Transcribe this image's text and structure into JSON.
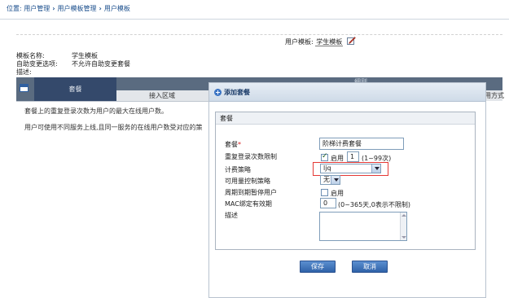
{
  "breadcrumb": {
    "prefix": "位置:",
    "items": [
      "用户管理",
      "用户模板管理",
      "用户模板"
    ]
  },
  "template_header": {
    "label": "用户模板:",
    "value": "学生模板"
  },
  "info": {
    "name_label": "模板名称:",
    "name_value": "学生模板",
    "selfchange_label": "自助变更选项:",
    "selfchange_value": "不允许自助变更套餐",
    "desc_label": "描述:"
  },
  "table": {
    "col_package": "套餐",
    "col_region": "接入区域",
    "col_stat": "细则",
    "col_method": "用方式"
  },
  "notes": {
    "line1": "套餐上的重复登录次数为用户的最大在线用户数。",
    "line2": "用户可使用不同服务上线,且同一服务的在线用户数受对应的策"
  },
  "dialog": {
    "title": "添加套餐",
    "section_title": "套餐",
    "fields": {
      "package_label": "套餐",
      "package_required": "*",
      "package_value": "阶梯计费套餐",
      "repeat_login_label": "重复登录次数限制",
      "repeat_enable_label": "启用",
      "repeat_count_value": "1",
      "repeat_hint": "(1~99次)",
      "billing_policy_label": "计费策略",
      "billing_policy_value": "ljq",
      "quota_policy_label": "可用量控制策略",
      "quota_policy_value": "无",
      "suspend_label": "周期到期暂停用户",
      "suspend_enable_label": "启用",
      "mac_label": "MAC绑定有效期",
      "mac_value": "0",
      "mac_hint": "(0~365天,0表示不限制)",
      "desc_label": "描述"
    },
    "buttons": {
      "save": "保存",
      "cancel": "取消"
    }
  },
  "colors": {
    "accent": "#2f62a8",
    "highlight_border": "#e53935",
    "table_header": "#34496b"
  }
}
